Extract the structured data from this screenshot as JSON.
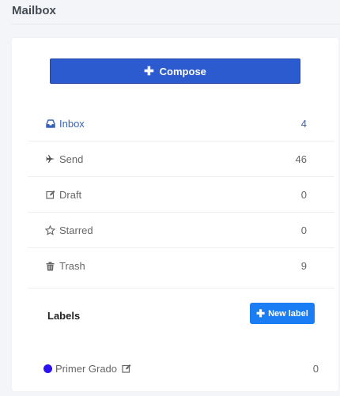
{
  "page": {
    "title": "Mailbox"
  },
  "compose": {
    "label": "Compose",
    "color": "#2c5bd0"
  },
  "menu": {
    "items": [
      {
        "label": "Inbox",
        "count": "4",
        "icon": "inbox-icon"
      },
      {
        "label": "Send",
        "count": "46",
        "icon": "plane-icon"
      },
      {
        "label": "Draft",
        "count": "0",
        "icon": "edit-icon"
      },
      {
        "label": "Starred",
        "count": "0",
        "icon": "star-icon"
      },
      {
        "label": "Trash",
        "count": "9",
        "icon": "trash-icon"
      }
    ],
    "active_color": "#3b63b5"
  },
  "labels": {
    "heading": "Labels",
    "new_label": "New label",
    "new_label_color": "#1a7df4",
    "items": [
      {
        "name": "Primer Grado",
        "count": "0",
        "color": "#2b10f0"
      }
    ]
  }
}
